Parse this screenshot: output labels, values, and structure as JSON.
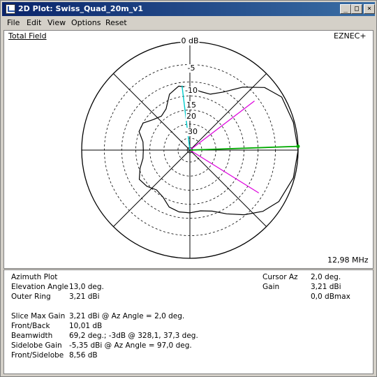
{
  "window": {
    "title": "2D Plot: Swiss_Quad_20m_v1",
    "min_glyph": "_",
    "max_glyph": "□",
    "close_glyph": "×"
  },
  "menu": {
    "items": [
      "File",
      "Edit",
      "View",
      "Options",
      "Reset"
    ]
  },
  "plot": {
    "field_label": "Total Field",
    "program": "EZNEC+",
    "frequency": "12,98 MHz",
    "ring_labels": [
      "0 dB",
      "-5",
      "-10",
      "15",
      "20",
      "-30"
    ],
    "colors": {
      "pattern": "#000000",
      "cursor": "#00aa00",
      "beamwidth": "#dd00dd",
      "sidelobe": "#00cccc"
    }
  },
  "chart_data": {
    "type": "polar",
    "title": "Total Field",
    "ring_labels_db": [
      "0 dB",
      "-5",
      "-10",
      "15",
      "20",
      "-30"
    ],
    "cursor_az_deg": 2.0,
    "beamwidth_edges_deg": [
      328.1,
      37.3
    ],
    "sidelobe_az_deg": 97.0,
    "pattern_r": [
      {
        "az": 0,
        "r": 1.0
      },
      {
        "az": 15,
        "r": 0.99
      },
      {
        "az": 30,
        "r": 0.98
      },
      {
        "az": 40,
        "r": 0.9
      },
      {
        "az": 50,
        "r": 0.76
      },
      {
        "az": 60,
        "r": 0.62
      },
      {
        "az": 70,
        "r": 0.55
      },
      {
        "az": 80,
        "r": 0.55
      },
      {
        "az": 90,
        "r": 0.58
      },
      {
        "az": 100,
        "r": 0.6
      },
      {
        "az": 110,
        "r": 0.55
      },
      {
        "az": 120,
        "r": 0.44
      },
      {
        "az": 130,
        "r": 0.41
      },
      {
        "az": 140,
        "r": 0.44
      },
      {
        "az": 150,
        "r": 0.5
      },
      {
        "az": 160,
        "r": 0.5
      },
      {
        "az": 170,
        "r": 0.44
      },
      {
        "az": 180,
        "r": 0.43
      },
      {
        "az": 190,
        "r": 0.44
      },
      {
        "az": 200,
        "r": 0.49
      },
      {
        "az": 210,
        "r": 0.54
      },
      {
        "az": 220,
        "r": 0.52
      },
      {
        "az": 230,
        "r": 0.48
      },
      {
        "az": 240,
        "r": 0.5
      },
      {
        "az": 250,
        "r": 0.56
      },
      {
        "az": 260,
        "r": 0.58
      },
      {
        "az": 270,
        "r": 0.58
      },
      {
        "az": 280,
        "r": 0.57
      },
      {
        "az": 290,
        "r": 0.6
      },
      {
        "az": 300,
        "r": 0.68
      },
      {
        "az": 310,
        "r": 0.78
      },
      {
        "az": 320,
        "r": 0.88
      },
      {
        "az": 330,
        "r": 0.95
      },
      {
        "az": 345,
        "r": 0.99
      }
    ]
  },
  "info": {
    "plot_type": "Azimuth Plot",
    "rows": [
      {
        "label": "Elevation Angle",
        "value": "13,0 deg."
      },
      {
        "label": "Outer Ring",
        "value": "3,21 dBi"
      }
    ],
    "cursor": [
      {
        "label": "Cursor Az",
        "value": "2,0 deg."
      },
      {
        "label": "Gain",
        "value": "3,21 dBi"
      },
      {
        "label": "",
        "value": "0,0 dBmax"
      }
    ],
    "stats": [
      {
        "label": "Slice Max Gain",
        "value": "3,21 dBi @ Az Angle = 2,0 deg."
      },
      {
        "label": "Front/Back",
        "value": "10,01 dB"
      },
      {
        "label": "Beamwidth",
        "value": "69,2 deg.; -3dB @ 328,1, 37,3 deg."
      },
      {
        "label": "Sidelobe Gain",
        "value": "-5,35 dBi @ Az Angle = 97,0 deg."
      },
      {
        "label": "Front/Sidelobe",
        "value": "8,56 dB"
      }
    ]
  }
}
